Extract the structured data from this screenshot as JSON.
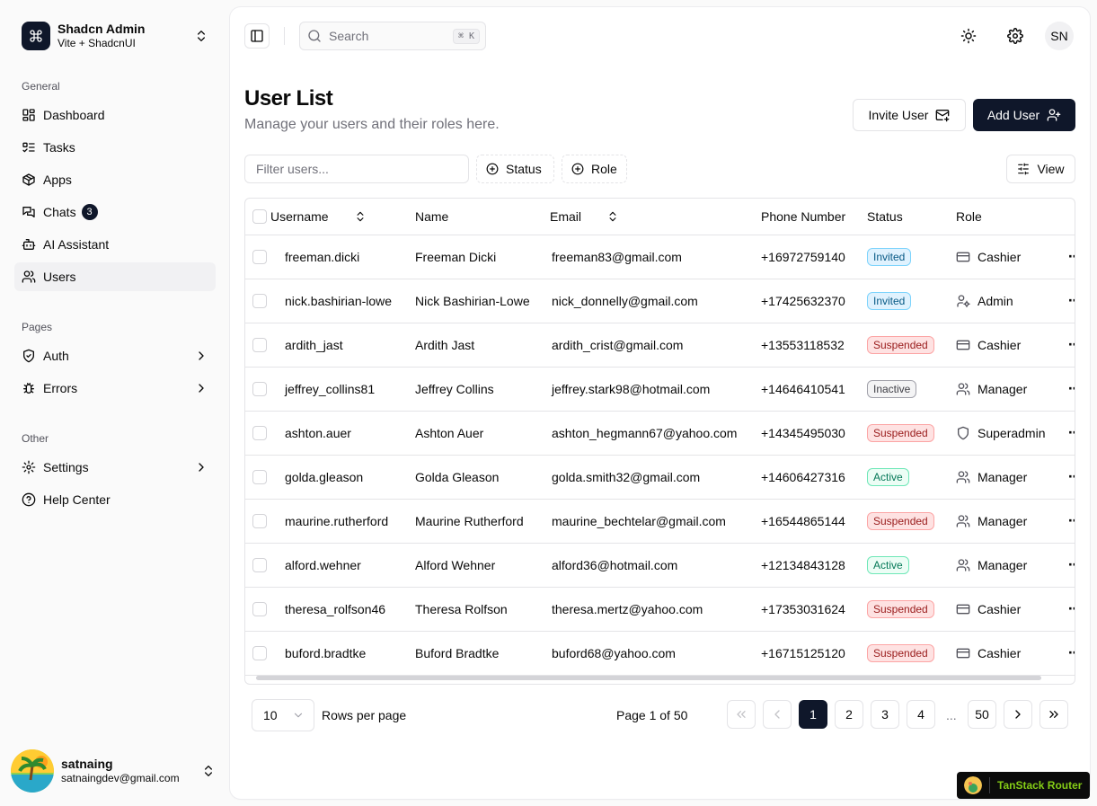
{
  "brand": {
    "title": "Shadcn Admin",
    "subtitle": "Vite + ShadcnUI"
  },
  "sidebar": {
    "groups": {
      "general": "General",
      "pages": "Pages",
      "other": "Other"
    },
    "items": [
      {
        "label": "Dashboard",
        "icon": "layout-dashboard-icon"
      },
      {
        "label": "Tasks",
        "icon": "list-todo-icon"
      },
      {
        "label": "Apps",
        "icon": "package-icon"
      },
      {
        "label": "Chats",
        "icon": "messages-icon",
        "badge": "3"
      },
      {
        "label": "AI Assistant",
        "icon": "bot-icon"
      },
      {
        "label": "Users",
        "icon": "users-icon",
        "active": true
      },
      {
        "label": "Auth",
        "icon": "shield-check-icon"
      },
      {
        "label": "Errors",
        "icon": "bug-icon"
      },
      {
        "label": "Settings",
        "icon": "settings-icon"
      },
      {
        "label": "Help Center",
        "icon": "help-circle-icon"
      }
    ]
  },
  "user": {
    "name": "satnaing",
    "email": "satnaingdev@gmail.com"
  },
  "topbar": {
    "search_placeholder": "Search",
    "shortcut": "⌘ K",
    "avatar_initials": "SN"
  },
  "page": {
    "title": "User List",
    "description": "Manage your users and their roles here.",
    "invite_label": "Invite User",
    "add_label": "Add User",
    "filter_placeholder": "Filter users...",
    "status_filter": "Status",
    "role_filter": "Role",
    "view_label": "View"
  },
  "table": {
    "columns": [
      "Username",
      "Name",
      "Email",
      "Phone Number",
      "Status",
      "Role"
    ],
    "rows": [
      {
        "username": "freeman.dicki",
        "name": "Freeman Dicki",
        "email": "freeman83@gmail.com",
        "phone": "+16972759140",
        "status": "Invited",
        "role": "Cashier"
      },
      {
        "username": "nick.bashirian-lowe",
        "name": "Nick Bashirian-Lowe",
        "email": "nick_donnelly@gmail.com",
        "phone": "+17425632370",
        "status": "Invited",
        "role": "Admin"
      },
      {
        "username": "ardith_jast",
        "name": "Ardith Jast",
        "email": "ardith_crist@gmail.com",
        "phone": "+13553118532",
        "status": "Suspended",
        "role": "Cashier"
      },
      {
        "username": "jeffrey_collins81",
        "name": "Jeffrey Collins",
        "email": "jeffrey.stark98@hotmail.com",
        "phone": "+14646410541",
        "status": "Inactive",
        "role": "Manager"
      },
      {
        "username": "ashton.auer",
        "name": "Ashton Auer",
        "email": "ashton_hegmann67@yahoo.com",
        "phone": "+14345495030",
        "status": "Suspended",
        "role": "Superadmin"
      },
      {
        "username": "golda.gleason",
        "name": "Golda Gleason",
        "email": "golda.smith32@gmail.com",
        "phone": "+14606427316",
        "status": "Active",
        "role": "Manager"
      },
      {
        "username": "maurine.rutherford",
        "name": "Maurine Rutherford",
        "email": "maurine_bechtelar@gmail.com",
        "phone": "+16544865144",
        "status": "Suspended",
        "role": "Manager"
      },
      {
        "username": "alford.wehner",
        "name": "Alford Wehner",
        "email": "alford36@hotmail.com",
        "phone": "+12134843128",
        "status": "Active",
        "role": "Manager"
      },
      {
        "username": "theresa_rolfson46",
        "name": "Theresa Rolfson",
        "email": "theresa.mertz@yahoo.com",
        "phone": "+17353031624",
        "status": "Suspended",
        "role": "Cashier"
      },
      {
        "username": "buford.bradtke",
        "name": "Buford Bradtke",
        "email": "buford68@yahoo.com",
        "phone": "+16715125120",
        "status": "Suspended",
        "role": "Cashier"
      }
    ]
  },
  "pagination": {
    "rows_per_page_value": "10",
    "rows_per_page_label": "Rows per page",
    "page_info": "Page 1 of 50",
    "pages": [
      "1",
      "2",
      "3",
      "4"
    ],
    "ellipsis": "...",
    "last_page": "50",
    "current_page": "1"
  },
  "devtools": {
    "label": "TanStack Router"
  },
  "colors": {
    "primary": "#0f172a",
    "invited": "#075985",
    "suspended": "#991b1b",
    "inactive": "#3f3f46",
    "active": "#047857",
    "devtools_text": "#84cc16"
  }
}
